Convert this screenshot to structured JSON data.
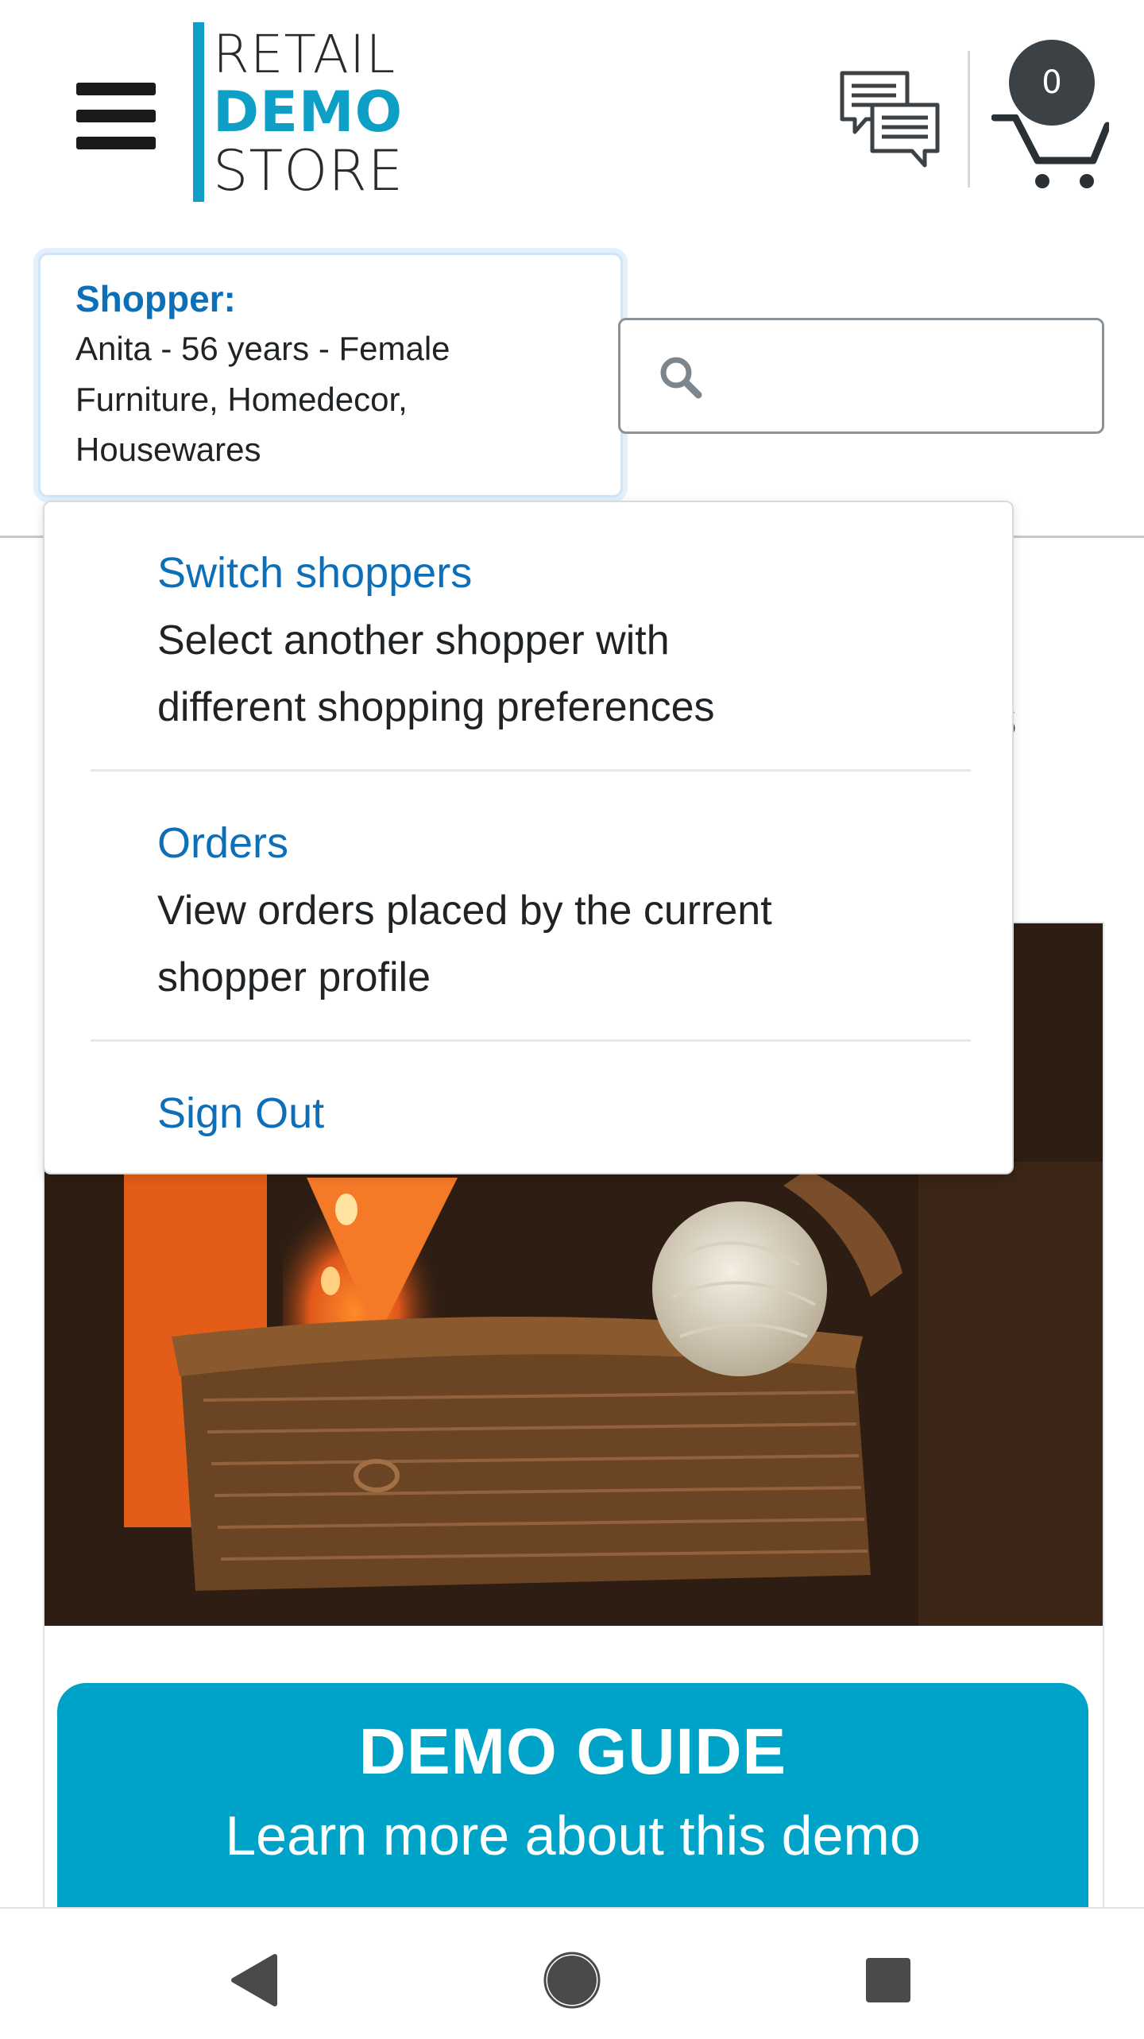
{
  "header": {
    "logo": {
      "line1": "RETAIL",
      "line2": "DEMO",
      "line3": "STORE"
    },
    "cart_count": "0"
  },
  "shopper": {
    "title": "Shopper:",
    "line1": "Anita - 56 years - Female",
    "line2": "Furniture, Homedecor,",
    "line3": "Housewares"
  },
  "search": {
    "placeholder": ""
  },
  "dropdown": {
    "items": [
      {
        "label": "Switch shoppers",
        "desc1": "Select another shopper with",
        "desc2": "different shopping preferences"
      },
      {
        "label": "Orders",
        "desc1": "View orders placed by the current",
        "desc2": "shopper profile"
      },
      {
        "label": "Sign Out"
      }
    ]
  },
  "background": {
    "partial_heading": "s"
  },
  "demo_guide": {
    "title": "DEMO GUIDE",
    "subtitle": "Learn more about this demo"
  },
  "colors": {
    "accent": "#00a3c8",
    "link": "#0c6fb8",
    "badge": "#3b4145"
  }
}
